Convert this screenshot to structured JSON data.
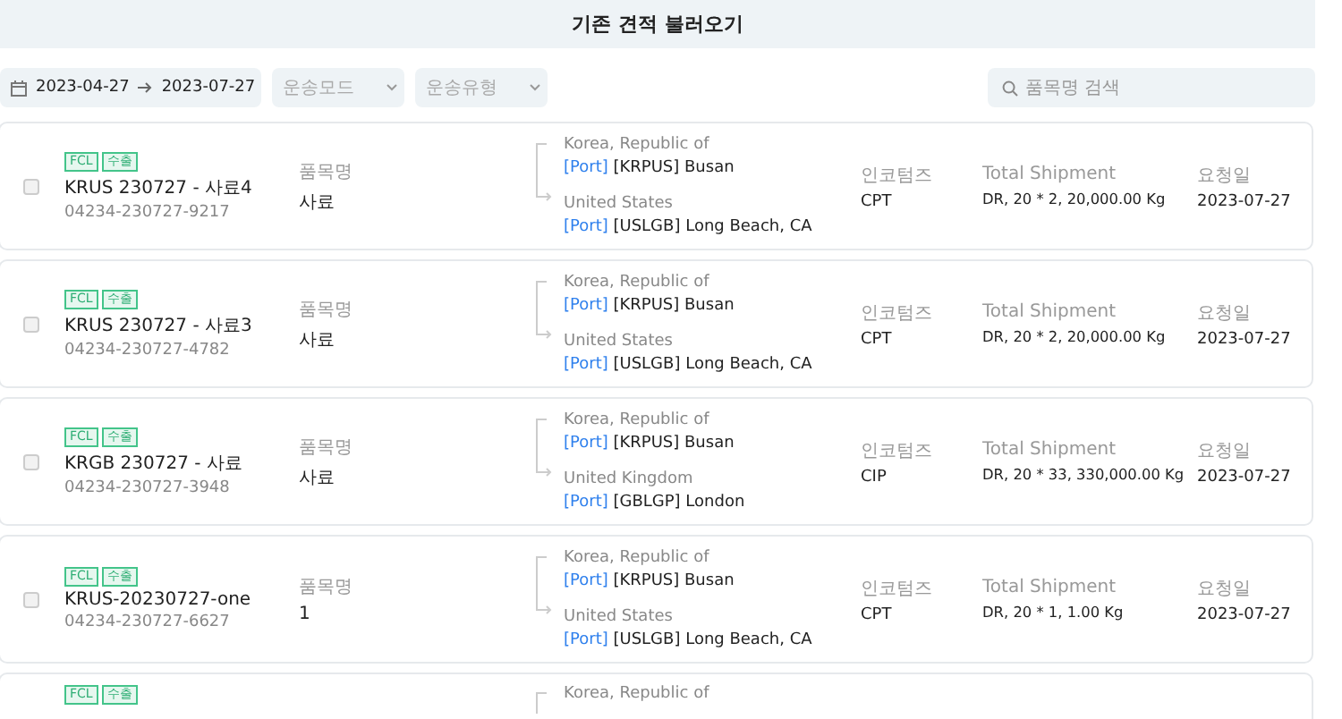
{
  "header": {
    "title": "기존 견적 불러오기"
  },
  "filters": {
    "date_from": "2023-04-27",
    "date_to": "2023-07-27",
    "dropdowns": [
      {
        "placeholder": "운송모드"
      },
      {
        "placeholder": "운송유형"
      }
    ],
    "search": {
      "placeholder": "품목명 검색"
    }
  },
  "quotes": [
    {
      "checked": false,
      "tags": [
        "FCL",
        "수출"
      ],
      "name": "KRUS 230727 - 사료4",
      "number": "04234-230727-9217",
      "item_label": "품목명",
      "item": "사료",
      "origin_country": "Korea, Republic of",
      "origin_tag": "[Port]",
      "origin_port": "[KRPUS] Busan",
      "dest_country": "United States",
      "dest_tag": "[Port]",
      "dest_port": "[USLGB] Long Beach, CA",
      "incoterms_label": "인코텀즈",
      "incoterms": "CPT",
      "shipment_label": "Total Shipment",
      "shipment": "DR, 20 * 2, 20,000.00 Kg",
      "date_label": "요청일",
      "date": "2023-07-27"
    },
    {
      "checked": false,
      "tags": [
        "FCL",
        "수출"
      ],
      "name": "KRUS 230727 - 사료3",
      "number": "04234-230727-4782",
      "item_label": "품목명",
      "item": "사료",
      "origin_country": "Korea, Republic of",
      "origin_tag": "[Port]",
      "origin_port": "[KRPUS] Busan",
      "dest_country": "United States",
      "dest_tag": "[Port]",
      "dest_port": "[USLGB] Long Beach, CA",
      "incoterms_label": "인코텀즈",
      "incoterms": "CPT",
      "shipment_label": "Total Shipment",
      "shipment": "DR, 20 * 2, 20,000.00 Kg",
      "date_label": "요청일",
      "date": "2023-07-27"
    },
    {
      "checked": false,
      "tags": [
        "FCL",
        "수출"
      ],
      "name": "KRGB 230727 - 사료",
      "number": "04234-230727-3948",
      "item_label": "품목명",
      "item": "사료",
      "origin_country": "Korea, Republic of",
      "origin_tag": "[Port]",
      "origin_port": "[KRPUS] Busan",
      "dest_country": "United Kingdom",
      "dest_tag": "[Port]",
      "dest_port": "[GBLGP] London",
      "incoterms_label": "인코텀즈",
      "incoterms": "CIP",
      "shipment_label": "Total Shipment",
      "shipment": "DR, 20 * 33, 330,000.00 Kg",
      "date_label": "요청일",
      "date": "2023-07-27"
    },
    {
      "checked": false,
      "tags": [
        "FCL",
        "수출"
      ],
      "name": "KRUS-20230727-one",
      "number": "04234-230727-6627",
      "item_label": "품목명",
      "item": "1",
      "origin_country": "Korea, Republic of",
      "origin_tag": "[Port]",
      "origin_port": "[KRPUS] Busan",
      "dest_country": "United States",
      "dest_tag": "[Port]",
      "dest_port": "[USLGB] Long Beach, CA",
      "incoterms_label": "인코텀즈",
      "incoterms": "CPT",
      "shipment_label": "Total Shipment",
      "shipment": "DR, 20 * 1, 1.00 Kg",
      "date_label": "요청일",
      "date": "2023-07-27"
    },
    {
      "tags": [
        "FCL",
        "수출"
      ],
      "origin_country": "Korea, Republic of"
    }
  ]
}
